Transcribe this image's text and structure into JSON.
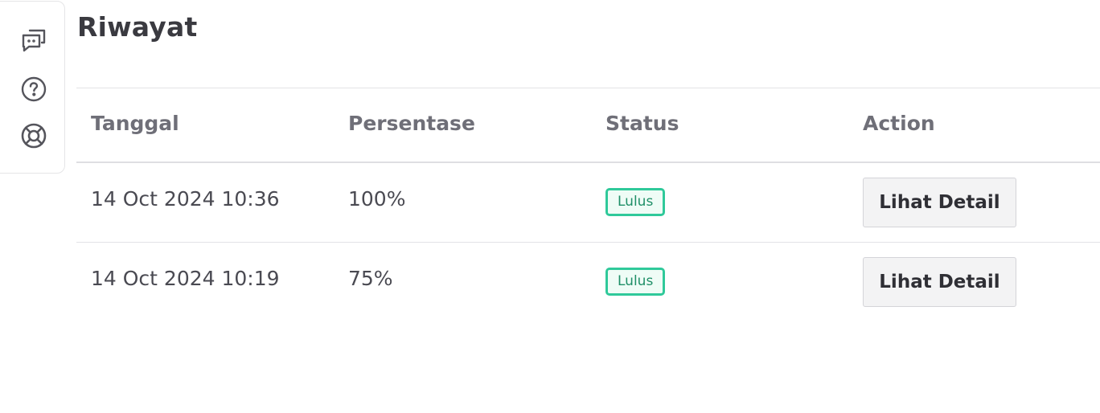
{
  "sidebar": {
    "icons": [
      "chat-icon",
      "help-icon",
      "support-icon"
    ]
  },
  "page": {
    "title": "Riwayat"
  },
  "table": {
    "headers": [
      "Tanggal",
      "Persentase",
      "Status",
      "Action"
    ],
    "rows": [
      {
        "tanggal": "14 Oct 2024 10:36",
        "persentase": "100%",
        "status": "Lulus",
        "action": "Lihat Detail"
      },
      {
        "tanggal": "14 Oct 2024 10:19",
        "persentase": "75%",
        "status": "Lulus",
        "action": "Lihat Detail"
      }
    ]
  },
  "colors": {
    "badge_border": "#2fc99a",
    "badge_text": "#1f8f67",
    "badge_bg": "#effcf6",
    "text_dark": "#3a3a40",
    "header_text": "#6f6f78"
  }
}
